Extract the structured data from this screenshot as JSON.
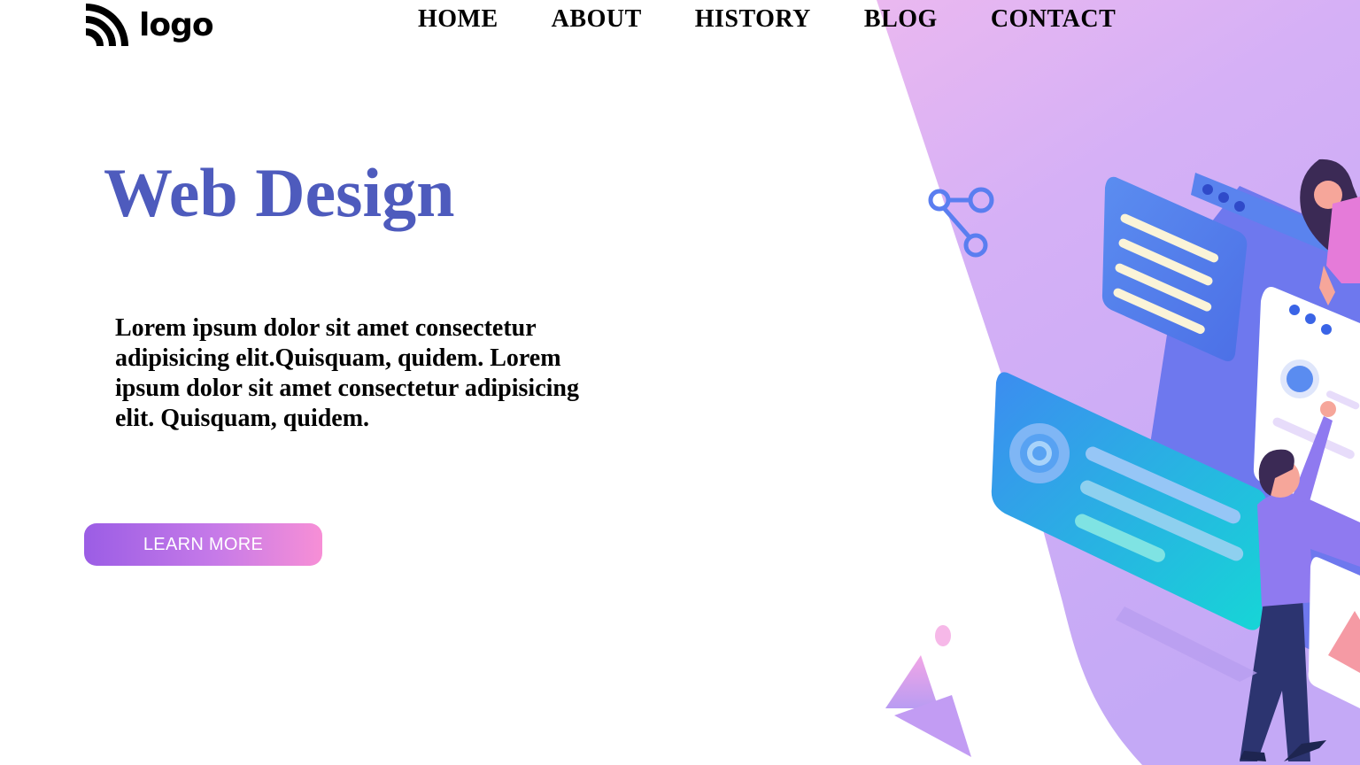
{
  "brand": {
    "logo_text": "logo"
  },
  "nav": {
    "items": [
      {
        "label": "HOME"
      },
      {
        "label": "ABOUT"
      },
      {
        "label": "HISTORY"
      },
      {
        "label": "BLOG"
      },
      {
        "label": "CONTACT"
      }
    ]
  },
  "hero": {
    "title": "Web Design",
    "text": "Lorem ipsum dolor sit amet consectetur adipisicing elit.Quisquam, quidem. Lorem ipsum dolor sit amet consectetur adipisicing elit. Quisquam, quidem.",
    "cta_label": "LEARN MORE"
  },
  "colors": {
    "title": "#4e5bbd",
    "accent_gradient_start": "#9b5de5",
    "accent_gradient_end": "#f78fd6",
    "background_shape": "#d8b4f8"
  },
  "icons": [
    "logo-mark-icon",
    "share-icon",
    "gear-icon"
  ]
}
